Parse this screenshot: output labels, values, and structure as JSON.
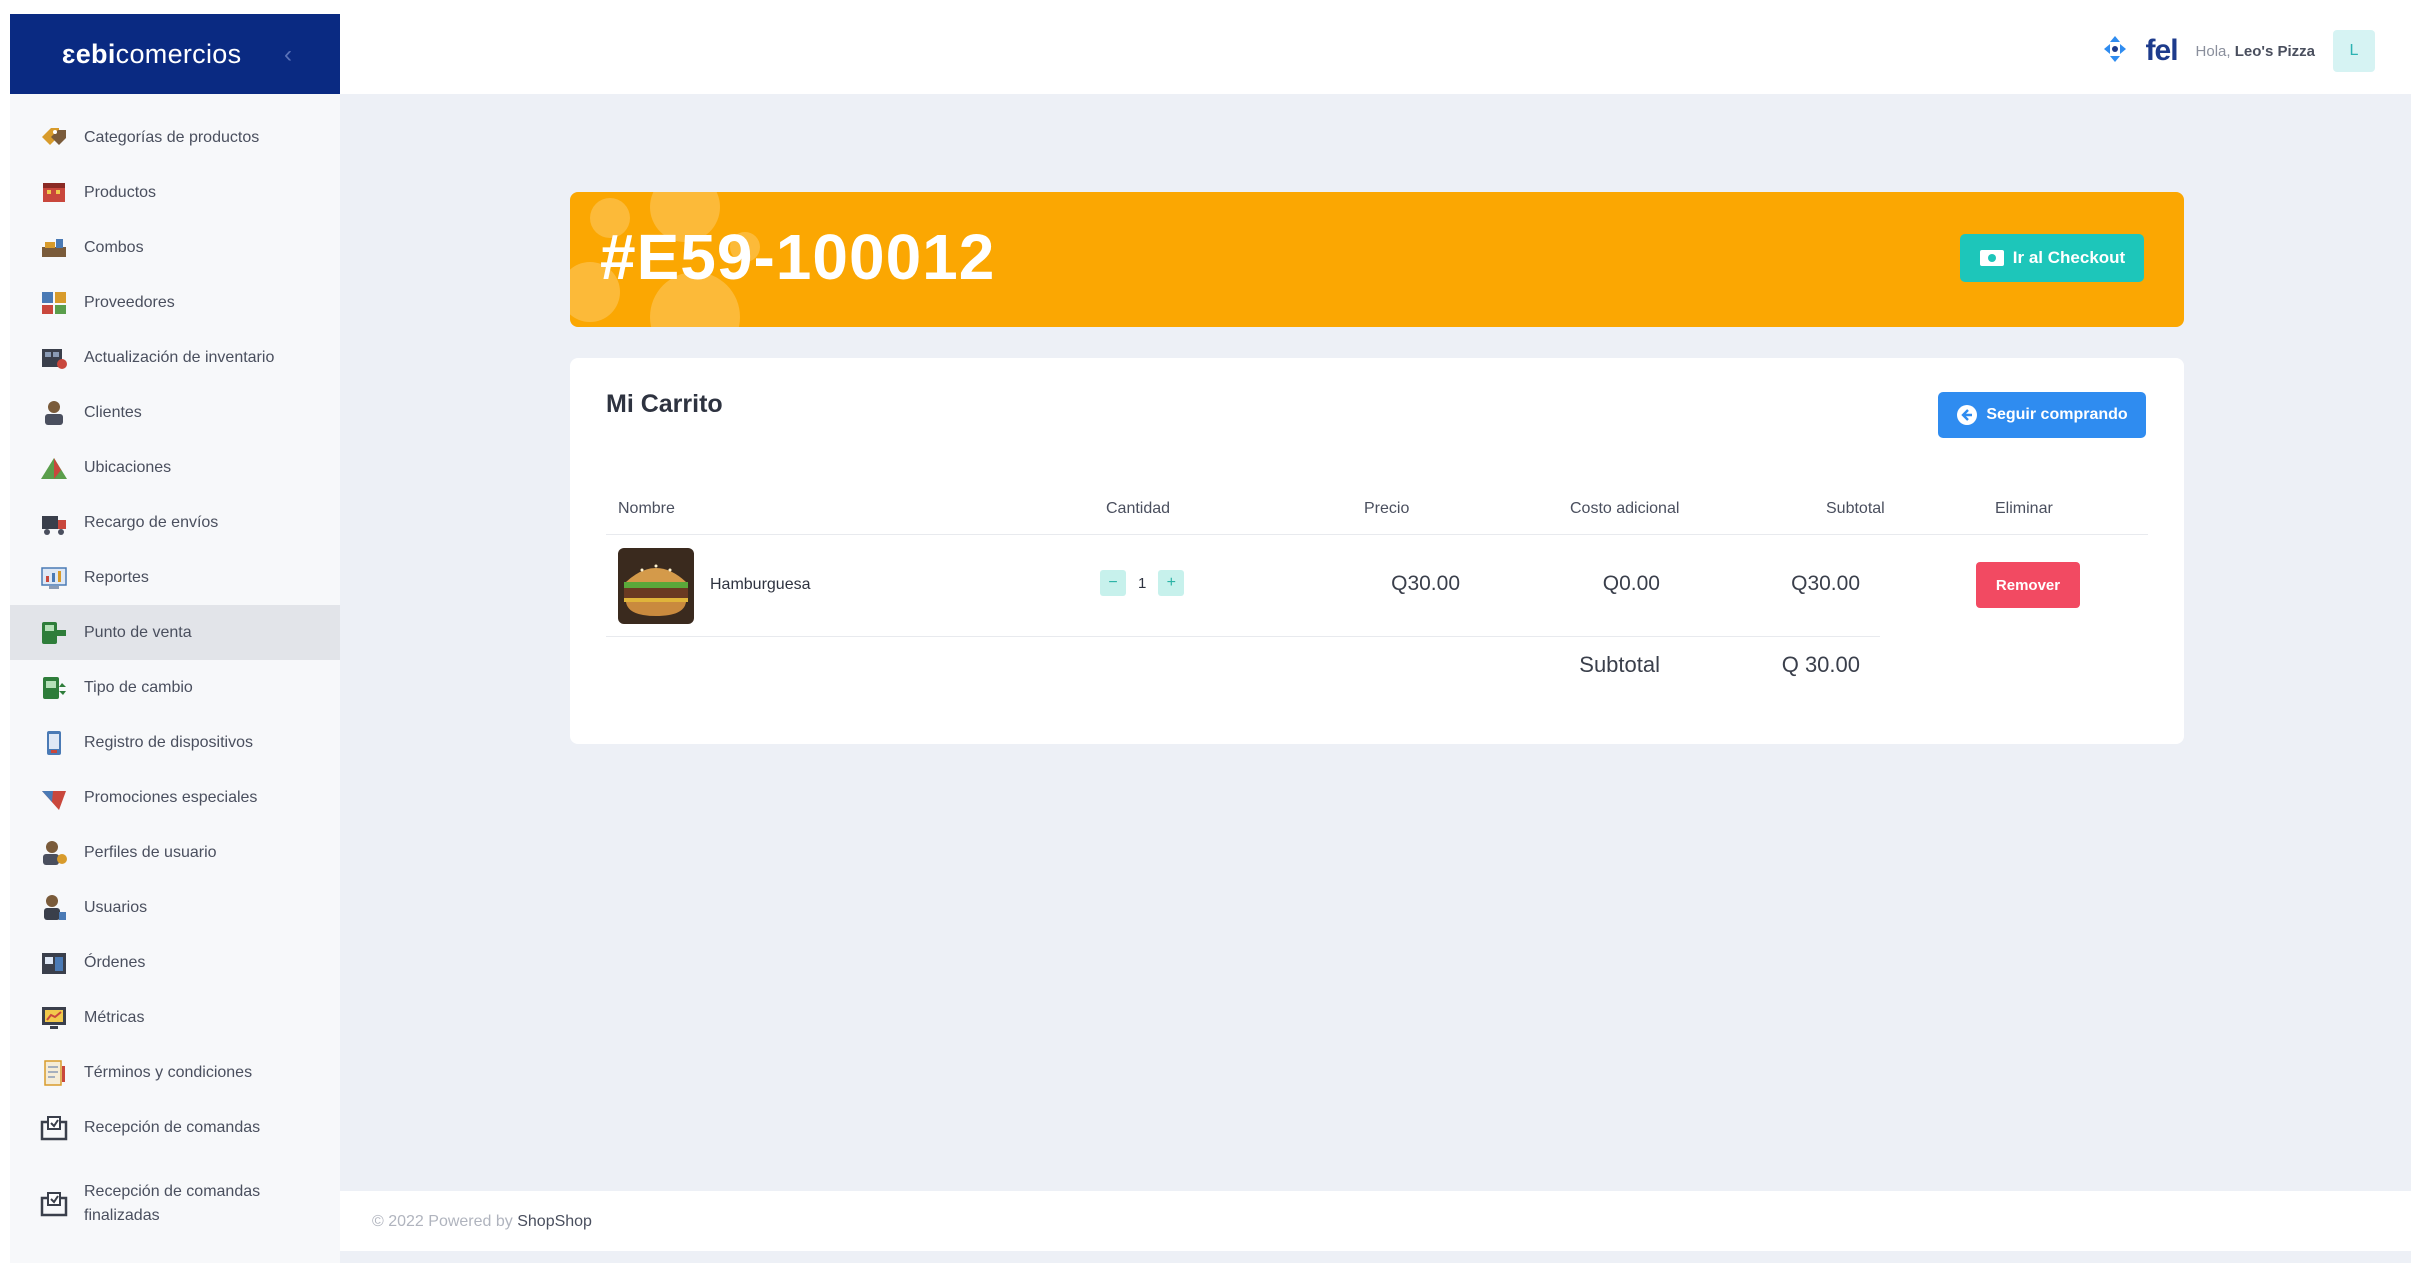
{
  "brand": {
    "prefix": "ebi",
    "suffix": "comercios"
  },
  "sidebar": {
    "items": [
      {
        "label": "Categorías de productos",
        "icon": "tags-icon"
      },
      {
        "label": "Productos",
        "icon": "products-icon"
      },
      {
        "label": "Combos",
        "icon": "combo-icon"
      },
      {
        "label": "Proveedores",
        "icon": "suppliers-icon"
      },
      {
        "label": "Actualización de inventario",
        "icon": "inventory-icon"
      },
      {
        "label": "Clientes",
        "icon": "client-icon"
      },
      {
        "label": "Ubicaciones",
        "icon": "location-icon"
      },
      {
        "label": "Recargo de envíos",
        "icon": "shipping-icon"
      },
      {
        "label": "Reportes",
        "icon": "reports-icon"
      },
      {
        "label": "Punto de venta",
        "icon": "pos-icon",
        "active": true
      },
      {
        "label": "Tipo de cambio",
        "icon": "exchange-icon"
      },
      {
        "label": "Registro de dispositivos",
        "icon": "device-icon"
      },
      {
        "label": "Promociones especiales",
        "icon": "promo-icon"
      },
      {
        "label": "Perfiles de usuario",
        "icon": "user-profile-icon"
      },
      {
        "label": "Usuarios",
        "icon": "users-icon"
      },
      {
        "label": "Órdenes",
        "icon": "orders-icon"
      },
      {
        "label": "Métricas",
        "icon": "metrics-icon"
      },
      {
        "label": "Términos y condiciones",
        "icon": "terms-icon"
      },
      {
        "label": "Recepción de comandas",
        "icon": "kitchen-orders-icon"
      },
      {
        "label_line1": "Recepción de comandas",
        "label_line2": "finalizadas",
        "icon": "kitchen-done-icon"
      }
    ]
  },
  "topbar": {
    "fel_logo": "fel",
    "greeting": "Hola,",
    "user_name": "Leo's Pizza",
    "avatar_initial": "L"
  },
  "order": {
    "id": "#E59-100012",
    "checkout_label": "Ir al Checkout"
  },
  "cart": {
    "title": "Mi Carrito",
    "keep_shopping_label": "Seguir comprando",
    "columns": [
      "Nombre",
      "Cantidad",
      "Precio",
      "Costo adicional",
      "Subtotal",
      "Eliminar"
    ],
    "items": [
      {
        "name": "Hamburguesa",
        "qty_minus": "−",
        "quantity": "1",
        "qty_plus": "+",
        "price": "Q30.00",
        "extra_cost": "Q0.00",
        "subtotal": "Q30.00",
        "remove_label": "Remover"
      }
    ],
    "subtotal_label": "Subtotal",
    "subtotal_value": "Q 30.00"
  },
  "footer": {
    "copyright": "© 2022 Powered by",
    "powered_by": "ShopShop"
  },
  "colors": {
    "brand_navy": "#0a2a82",
    "banner_orange": "#fba702",
    "checkout_teal": "#1dc6ba",
    "primary_blue": "#2f8cf0",
    "danger_red": "#f24a62",
    "main_bg": "#edf0f6"
  }
}
